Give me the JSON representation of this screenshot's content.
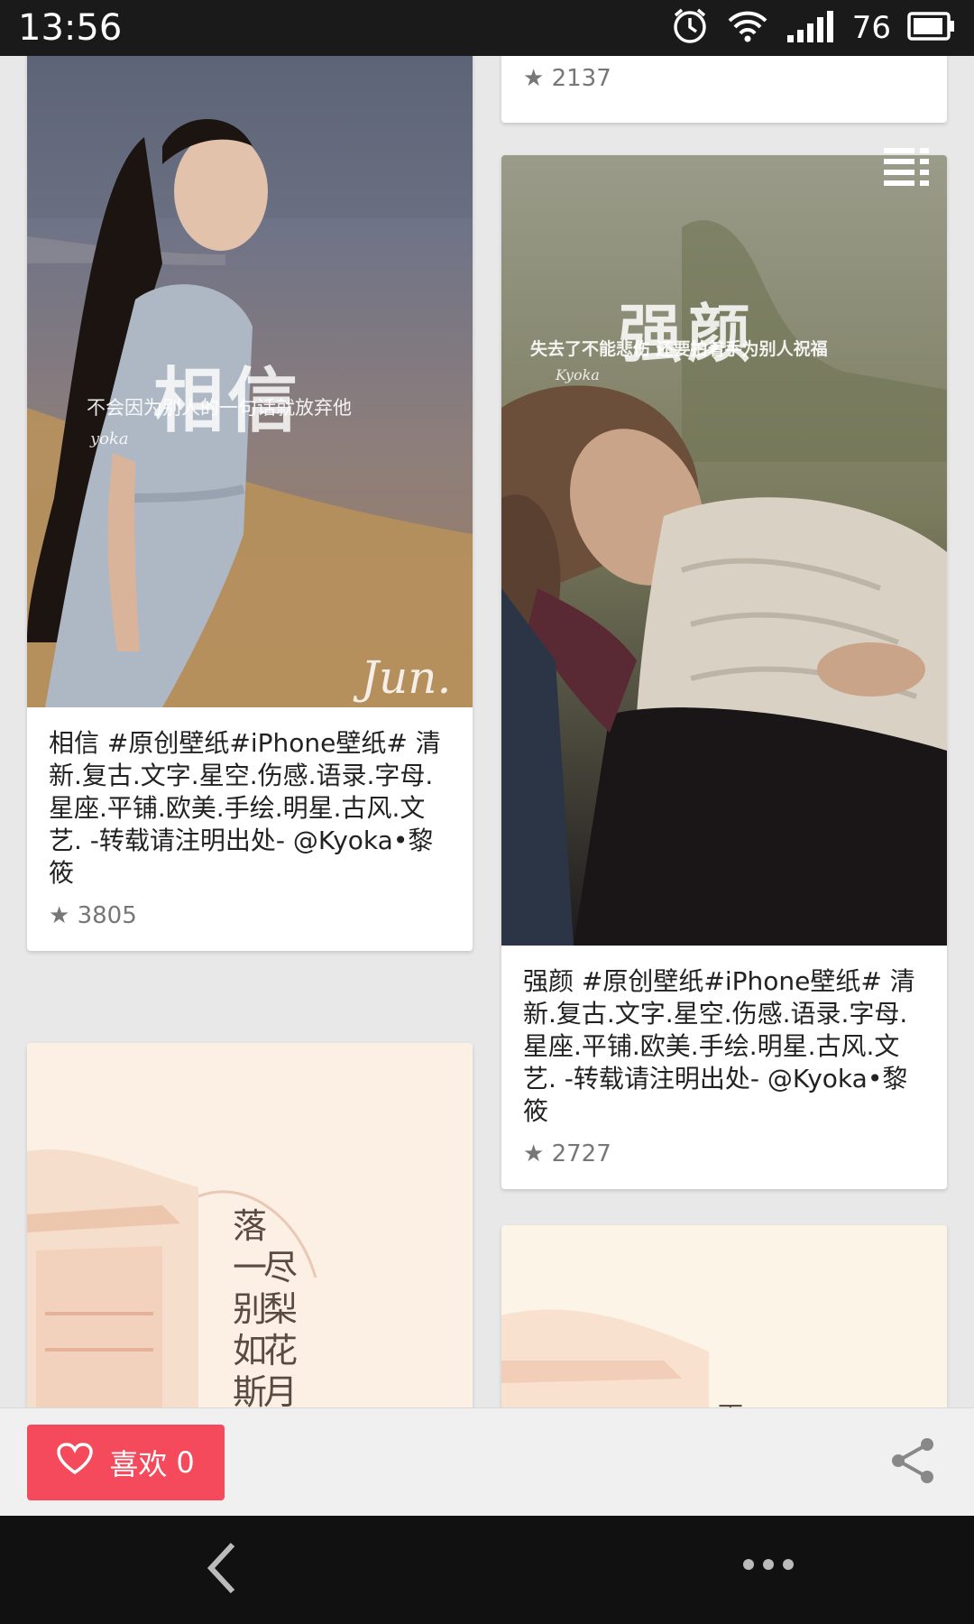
{
  "status_bar": {
    "time": "13:56",
    "battery_level": "76"
  },
  "cards": [
    {
      "stars": "★ 2137"
    },
    {
      "image_title": "相信",
      "image_caption": "不会因为别人的一句话就放弃他",
      "image_sign": "yoka",
      "image_signature": "Jun.",
      "description": "相信 #原创壁纸#iPhone壁纸# 清新.复古.文字.星空.伤感.语录.字母.星座.平铺.欧美.手绘.明星.古风.文艺. -转载请注明出处- @Kyoka•黎筱",
      "stars": "★ 3805"
    },
    {
      "image_title": "强颜",
      "image_caption": "失去了不能悲伤 还要拍着手为别人祝福",
      "image_sign": "Kyoka",
      "description": "强颜 #原创壁纸#iPhone壁纸# 清新.复古.文字.星空.伤感.语录.字母.星座.平铺.欧美.手绘.明星.古风.文艺. -转载请注明出处- @Kyoka•黎筱",
      "stars": "★ 2727"
    },
    {
      "image_text_a": "落一别如斯",
      "image_text_b": "尽梨花月"
    },
    {
      "image_text": "雨"
    }
  ],
  "actions": {
    "like_label": "喜欢",
    "like_count": "0"
  },
  "icons": {
    "alarm": "alarm-icon",
    "wifi": "wifi-icon",
    "signal": "signal-icon",
    "battery": "battery-icon",
    "menu": "list-menu-icon",
    "heart": "heart-icon",
    "share": "share-icon",
    "back": "back-icon",
    "more": "more-icon"
  },
  "colors": {
    "like_button": "#f44a5b",
    "status_bar": "#1a1a1a",
    "nav_bar": "#111111"
  }
}
